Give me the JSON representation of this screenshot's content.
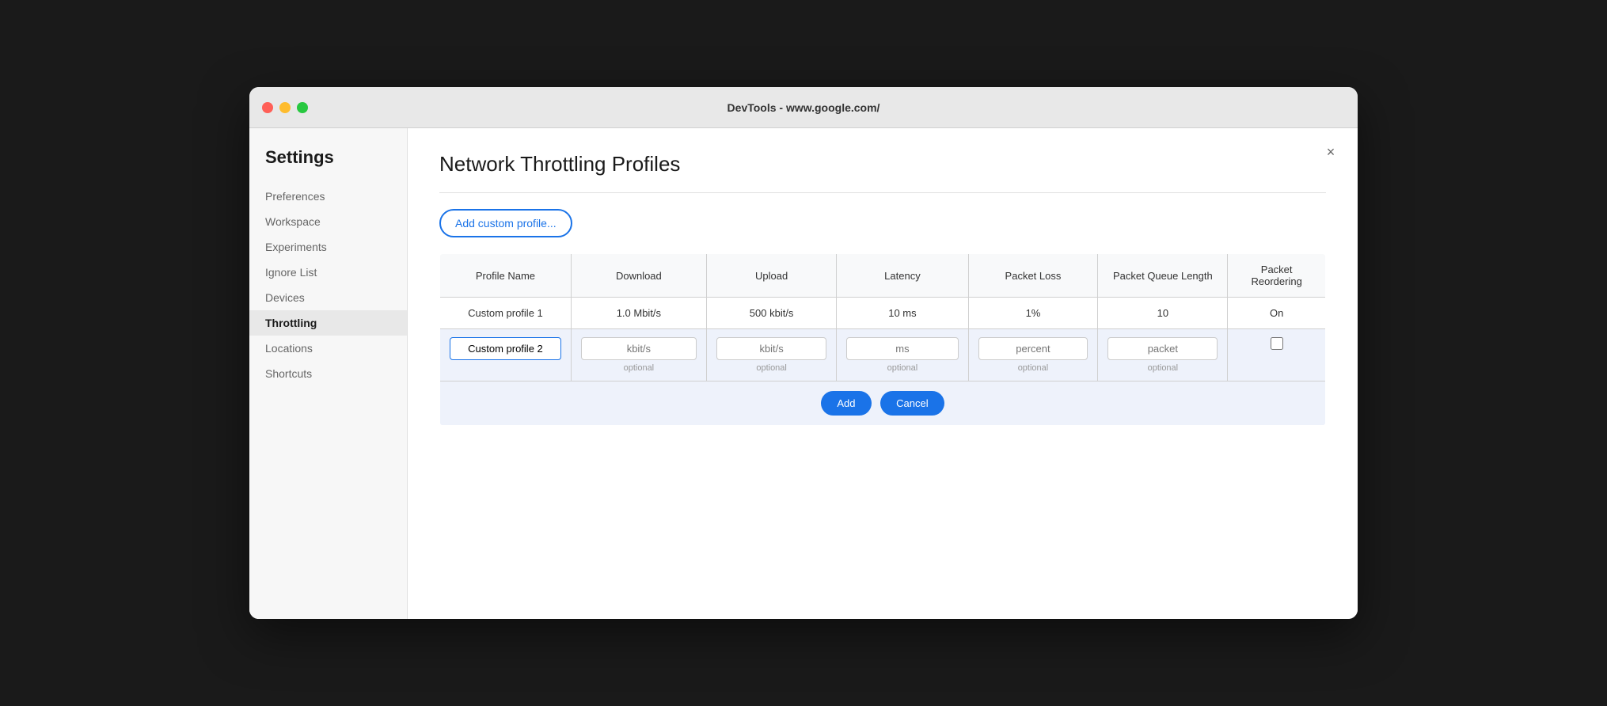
{
  "window": {
    "title": "DevTools - www.google.com/"
  },
  "titlebar": {
    "close_label": "×",
    "minimize_label": "−",
    "maximize_label": "+"
  },
  "sidebar": {
    "title": "Settings",
    "items": [
      {
        "id": "preferences",
        "label": "Preferences",
        "active": false
      },
      {
        "id": "workspace",
        "label": "Workspace",
        "active": false
      },
      {
        "id": "experiments",
        "label": "Experiments",
        "active": false
      },
      {
        "id": "ignore-list",
        "label": "Ignore List",
        "active": false
      },
      {
        "id": "devices",
        "label": "Devices",
        "active": false
      },
      {
        "id": "throttling",
        "label": "Throttling",
        "active": true
      },
      {
        "id": "locations",
        "label": "Locations",
        "active": false
      },
      {
        "id": "shortcuts",
        "label": "Shortcuts",
        "active": false
      }
    ]
  },
  "main": {
    "title": "Network Throttling Profiles",
    "add_button_label": "Add custom profile...",
    "close_icon": "×",
    "table": {
      "headers": [
        "Profile Name",
        "Download",
        "Upload",
        "Latency",
        "Packet Loss",
        "Packet Queue Length",
        "Packet Reordering"
      ],
      "existing_rows": [
        {
          "name": "Custom profile 1",
          "download": "1.0 Mbit/s",
          "upload": "500 kbit/s",
          "latency": "10 ms",
          "packet_loss": "1%",
          "packet_queue": "10",
          "packet_reordering": "On"
        }
      ],
      "new_row": {
        "name_value": "Custom profile 2",
        "download_placeholder": "kbit/s",
        "download_hint": "optional",
        "upload_placeholder": "kbit/s",
        "upload_hint": "optional",
        "latency_placeholder": "ms",
        "latency_hint": "optional",
        "packet_loss_placeholder": "percent",
        "packet_loss_hint": "optional",
        "packet_queue_placeholder": "packet",
        "packet_queue_hint": "optional"
      },
      "add_button": "Add",
      "cancel_button": "Cancel"
    }
  }
}
